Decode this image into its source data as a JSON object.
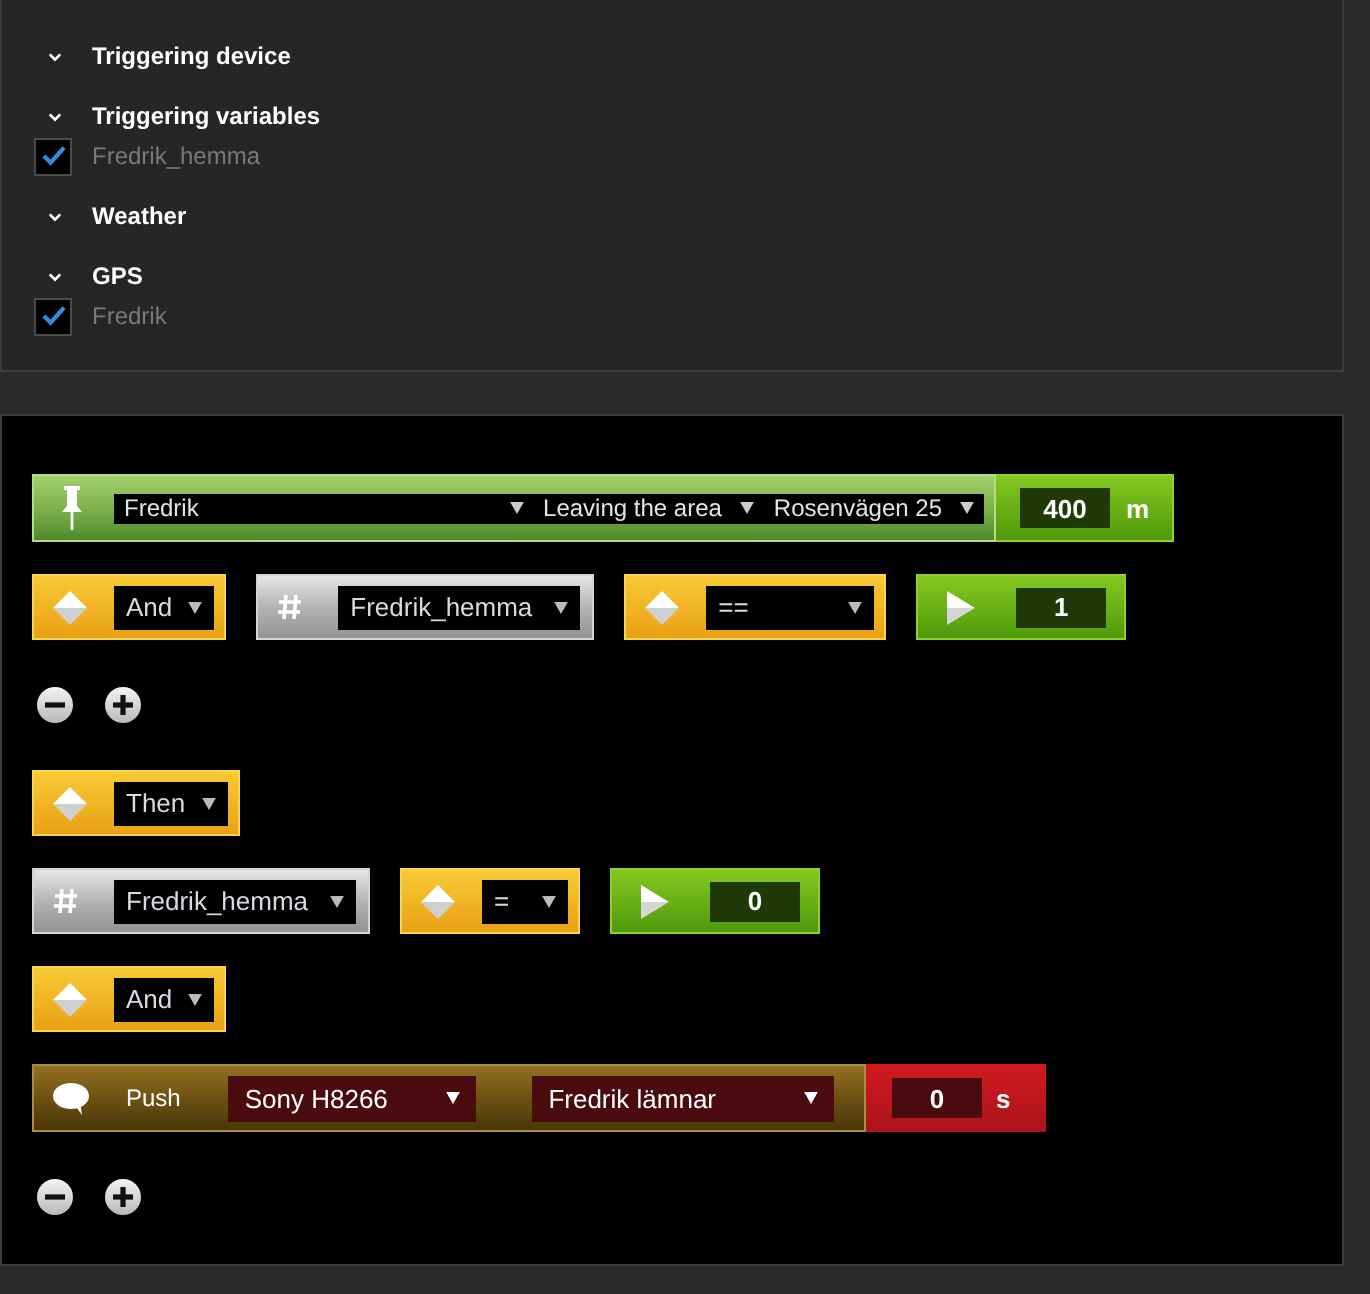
{
  "filters": {
    "sections": [
      {
        "title": "Triggering device"
      },
      {
        "title": "Triggering variables",
        "items": [
          {
            "label": "Fredrik_hemma",
            "checked": true
          }
        ]
      },
      {
        "title": "Weather"
      },
      {
        "title": "GPS",
        "items": [
          {
            "label": "Fredrik",
            "checked": true
          }
        ]
      }
    ]
  },
  "rules": {
    "rows": [
      {
        "kind": "blocks",
        "blocks": [
          {
            "kind": "location",
            "selects": [
              "Fredrik",
              "Leaving the area",
              "Rosenvägen 25"
            ],
            "value": "400",
            "unit": "m"
          }
        ]
      },
      {
        "kind": "blocks",
        "blocks": [
          {
            "kind": "logic",
            "value": "And"
          },
          {
            "kind": "variable",
            "value": "Fredrik_hemma"
          },
          {
            "kind": "compare",
            "value": "=="
          },
          {
            "kind": "number",
            "value": "1"
          }
        ]
      },
      {
        "kind": "add_remove"
      },
      {
        "kind": "blocks",
        "blocks": [
          {
            "kind": "logic",
            "value": "Then"
          }
        ]
      },
      {
        "kind": "blocks",
        "blocks": [
          {
            "kind": "variable",
            "value": "Fredrik_hemma"
          },
          {
            "kind": "assign",
            "value": "="
          },
          {
            "kind": "number",
            "value": "0"
          }
        ]
      },
      {
        "kind": "blocks",
        "blocks": [
          {
            "kind": "logic",
            "value": "And"
          }
        ]
      },
      {
        "kind": "blocks",
        "blocks": [
          {
            "kind": "push",
            "label": "Push",
            "selects": [
              "Sony H8266",
              "Fredrik lämnar"
            ],
            "value": "0",
            "unit": "s"
          }
        ]
      },
      {
        "kind": "add_remove"
      }
    ]
  }
}
